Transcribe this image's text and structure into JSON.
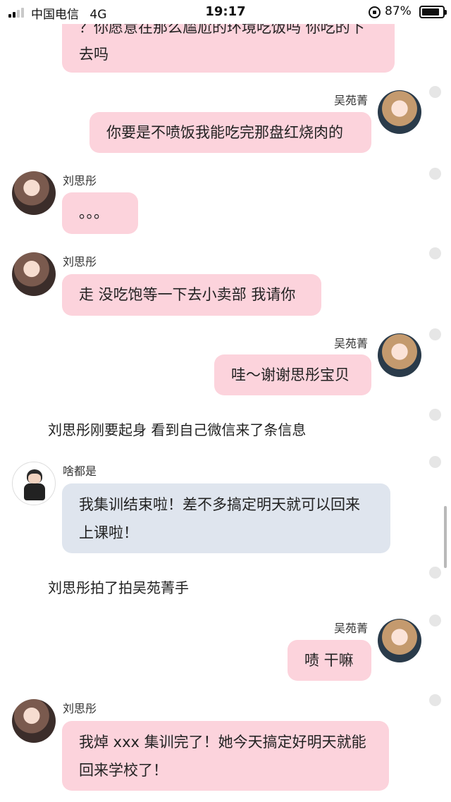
{
  "status_bar": {
    "carrier": "中国电信",
    "network": "4G",
    "time": "19:17",
    "battery": "87%",
    "battery_level": 0.87
  },
  "messages": [
    {
      "type": "left",
      "text_lines": [
        "？你愿意在那么尴尬的环境吃饭吗 你吃的下",
        "去吗"
      ]
    },
    {
      "type": "right",
      "sender": "吴苑菁",
      "text": "你要是不喷饭我能吃完那盘红烧肉的"
    },
    {
      "type": "left",
      "sender": "刘思彤",
      "text": "。。。"
    },
    {
      "type": "left",
      "sender": "刘思彤",
      "text": "走 没吃饱等一下去小卖部 我请你"
    },
    {
      "type": "right",
      "sender": "吴苑菁",
      "text": "哇～谢谢思彤宝贝"
    },
    {
      "type": "narration",
      "text": "刘思彤刚要起身 看到自己微信来了条信息"
    },
    {
      "type": "left",
      "sender": "啥都是",
      "text_lines": [
        "我集训结束啦！差不多搞定明天就可以回来",
        "上课啦！"
      ]
    },
    {
      "type": "narration",
      "text": "刘思彤拍了拍吴苑菁手"
    },
    {
      "type": "right",
      "sender": "吴苑菁",
      "text": "啧 干嘛"
    },
    {
      "type": "left",
      "sender": "刘思彤",
      "text_lines": [
        "我焯 xxx 集训完了！她今天搞定好明天就能",
        "回来学校了！"
      ]
    }
  ],
  "colors": {
    "pink_bubble": "#fcd3dc",
    "blue_bubble": "#dfe5ee",
    "background": "#ffffff"
  }
}
